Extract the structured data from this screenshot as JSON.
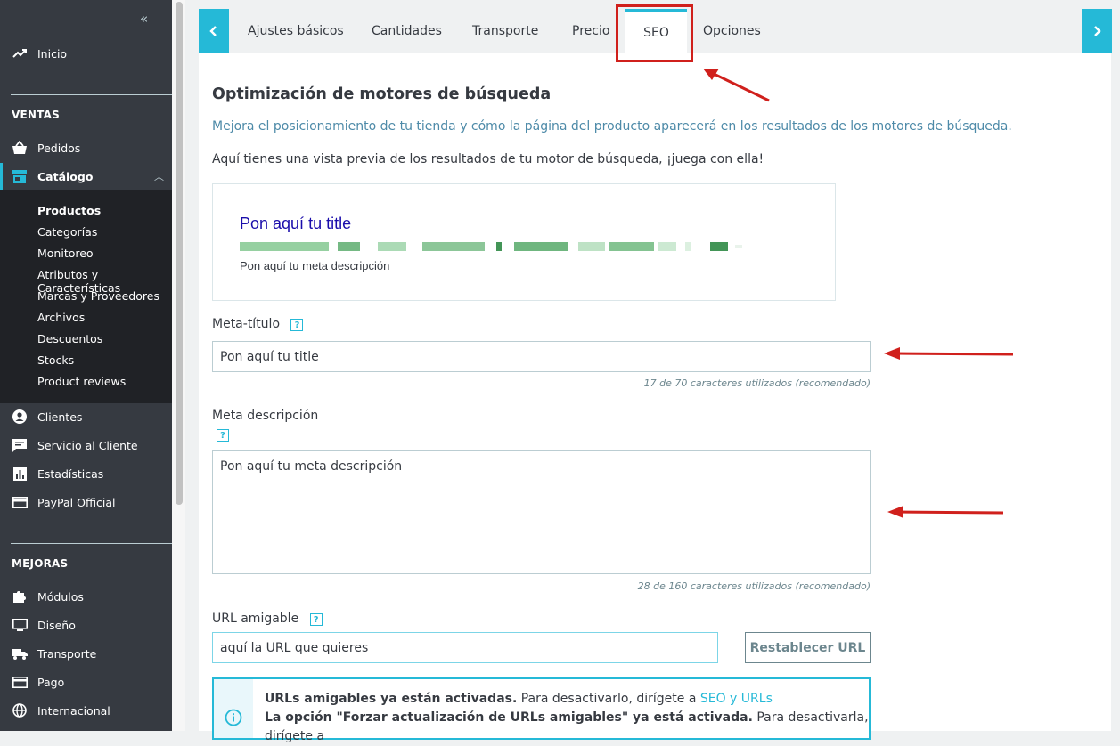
{
  "sidebar": {
    "collapse_label": "«",
    "home": "Inicio",
    "sections": [
      {
        "title": "VENTAS"
      },
      {
        "title": "MEJORAS"
      }
    ],
    "items_ventas": [
      {
        "label": "Pedidos",
        "icon": "basket-icon"
      },
      {
        "label": "Catálogo",
        "icon": "store-icon"
      }
    ],
    "catalog_sub": [
      "Productos",
      "Categorías",
      "Monitoreo",
      "Atributos y Características",
      "Marcas y Proveedores",
      "Archivos",
      "Descuentos",
      "Stocks",
      "Product reviews"
    ],
    "items_after": [
      {
        "label": "Clientes",
        "icon": "user-icon"
      },
      {
        "label": "Servicio al Cliente",
        "icon": "chat-icon"
      },
      {
        "label": "Estadísticas",
        "icon": "stats-icon"
      },
      {
        "label": "PayPal Official",
        "icon": "card-icon"
      }
    ],
    "items_mejoras": [
      {
        "label": "Módulos",
        "icon": "puzzle-icon"
      },
      {
        "label": "Diseño",
        "icon": "monitor-icon"
      },
      {
        "label": "Transporte",
        "icon": "truck-icon"
      },
      {
        "label": "Pago",
        "icon": "card-icon"
      },
      {
        "label": "Internacional",
        "icon": "globe-icon"
      }
    ]
  },
  "tabs": [
    "Ajustes básicos",
    "Cantidades",
    "Transporte",
    "Precio",
    "SEO",
    "Opciones"
  ],
  "active_tab": "SEO",
  "seo": {
    "heading": "Optimización de motores de búsqueda",
    "intro": "Mejora el posicionamiento de tu tienda y cómo la página del producto aparecerá en los resultados de los motores de búsqueda.",
    "preview_intro": "Aquí tienes una vista previa de los resultados de tu motor de búsqueda, ¡juega con ella!",
    "preview": {
      "title": "Pon aquí tu title",
      "description": "Pon aquí tu meta descripción"
    },
    "meta_title_label": "Meta-título",
    "meta_title_value": "Pon aquí tu title",
    "meta_title_hint": "17 de 70 caracteres utilizados (recomendado)",
    "meta_desc_label": "Meta descripción",
    "meta_desc_value": "Pon aquí tu meta descripción",
    "meta_desc_hint": "28 de 160 caracteres utilizados (recomendado)",
    "url_label": "URL amigable",
    "url_value": "aquí la URL que quieres",
    "reset_button": "Restablecer URL",
    "help_glyph": "?",
    "alert": {
      "line1_bold": "URLs amigables ya están activadas.",
      "line1_rest": " Para desactivarlo, dirígete a ",
      "line1_link": "SEO y URLs",
      "line2_bold": "La opción \"Forzar actualización de URLs amigables\" ya está activada.",
      "line2_rest": " Para desactivarla, dirígete a"
    }
  },
  "colors": {
    "accent": "#25b9d7",
    "sidebar": "#363a41",
    "annotation": "#d0201c"
  }
}
